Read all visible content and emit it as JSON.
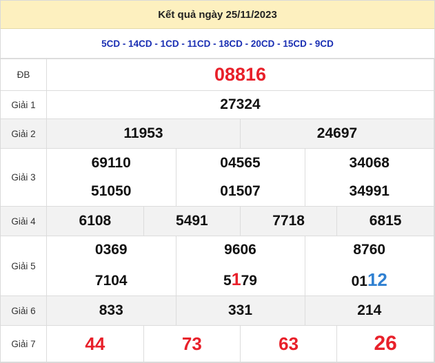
{
  "header": {
    "title": "Kết quả ngày 25/11/2023"
  },
  "codes": "5CD - 14CD - 1CD - 11CD - 18CD - 20CD - 15CD - 9CD",
  "labels": {
    "db": "ĐB",
    "g1": "Giải 1",
    "g2": "Giải 2",
    "g3": "Giải 3",
    "g4": "Giải 4",
    "g5": "Giải 5",
    "g6": "Giải 6",
    "g7": "Giải 7"
  },
  "prizes": {
    "db": "08816",
    "g1": "27324",
    "g2": [
      "11953",
      "24697"
    ],
    "g3": [
      "69110",
      "04565",
      "34068",
      "51050",
      "01507",
      "34991"
    ],
    "g4": [
      "6108",
      "5491",
      "7718",
      "6815"
    ],
    "g5": {
      "row1": [
        "0369",
        "9606",
        "8760"
      ],
      "row2": [
        {
          "pre": "7104",
          "hl": "",
          "post": ""
        },
        {
          "pre": "5",
          "hl": "1",
          "post": "79"
        },
        {
          "pre": "01",
          "hl": "12",
          "post": ""
        }
      ]
    },
    "g6": [
      "833",
      "331",
      "214"
    ],
    "g7": [
      "44",
      "73",
      "63",
      "26"
    ]
  },
  "colors": {
    "header_bg": "#fdf0bf",
    "codes": "#1a2fb3",
    "red": "#e8202a",
    "blue": "#2f80d1",
    "row_gray": "#f2f2f2"
  }
}
